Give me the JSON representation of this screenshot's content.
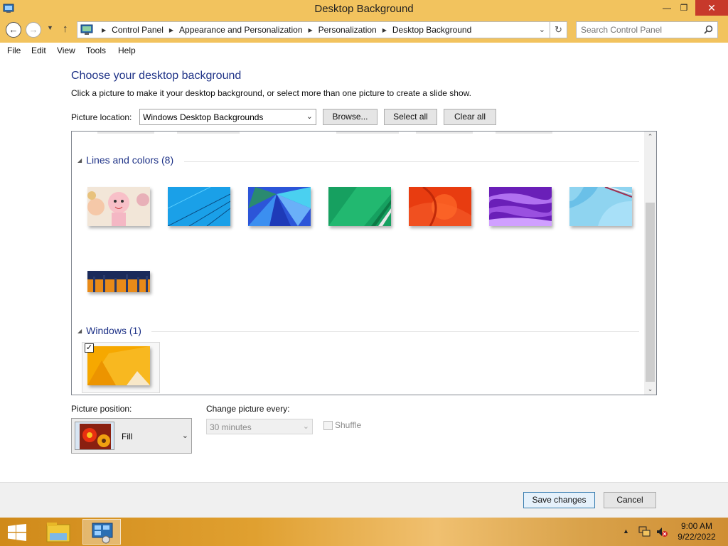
{
  "window": {
    "title": "Desktop Background",
    "controls": {
      "minimize": "—",
      "restore": "❐",
      "close": "✕"
    }
  },
  "nav": {
    "back_icon": "back-arrow-icon",
    "forward_icon": "forward-arrow-icon",
    "breadcrumb": [
      "Control Panel",
      "Appearance and Personalization",
      "Personalization",
      "Desktop Background"
    ],
    "search_placeholder": "Search Control Panel"
  },
  "menu": [
    "File",
    "Edit",
    "View",
    "Tools",
    "Help"
  ],
  "main": {
    "heading": "Choose your desktop background",
    "subtext": "Click a picture to make it your desktop background, or select more than one picture to create a slide show.",
    "picture_location_label": "Picture location:",
    "picture_location_value": "Windows Desktop Backgrounds",
    "browse_label": "Browse...",
    "select_all_label": "Select all",
    "clear_all_label": "Clear all"
  },
  "groups": [
    {
      "title": "Lines and colors (8)",
      "expanded": true,
      "items": [
        "cartoon-characters",
        "blue-lines",
        "blue-petals",
        "green-ribbon",
        "orange-swirl",
        "purple-waves",
        "light-blue-lines",
        "orange-blue-bars"
      ]
    },
    {
      "title": "Windows (1)",
      "expanded": true,
      "items": [
        "windows-orange-fold"
      ],
      "selected": [
        true
      ]
    }
  ],
  "options": {
    "picture_position_label": "Picture position:",
    "picture_position_value": "Fill",
    "change_picture_label": "Change picture every:",
    "change_picture_value": "30 minutes",
    "change_picture_enabled": false,
    "shuffle_label": "Shuffle",
    "shuffle_checked": false
  },
  "footer": {
    "save_label": "Save changes",
    "cancel_label": "Cancel"
  },
  "taskbar": {
    "time": "9:00 AM",
    "date": "9/22/2022"
  }
}
